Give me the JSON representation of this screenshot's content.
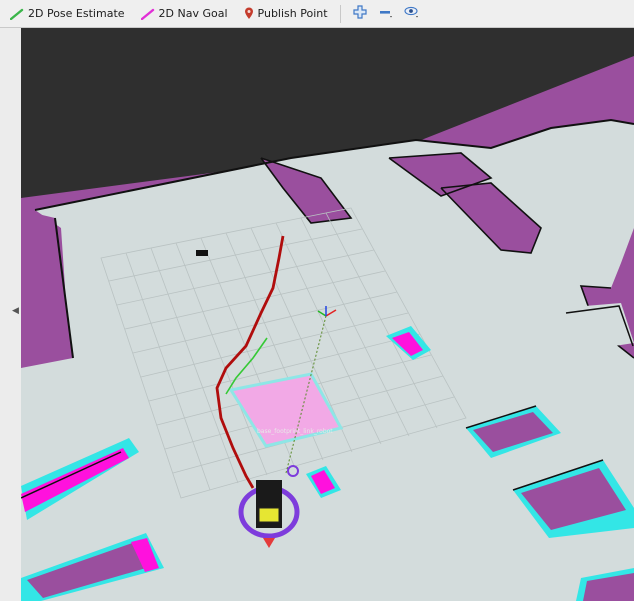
{
  "toolbar": {
    "pose_estimate": "2D Pose Estimate",
    "nav_goal": "2D Nav Goal",
    "publish_point": "Publish Point"
  },
  "icons": {
    "pose_estimate": "pose-arrow-icon",
    "nav_goal": "goal-arrow-icon",
    "publish_point": "map-pin-icon",
    "add": "move-cross-icon",
    "remove": "minus-icon",
    "view": "eye-icon"
  },
  "scene": {
    "colors": {
      "background": "#2f2f2f",
      "free_space": "#d3dcdc",
      "unknown": "#9a4f9e",
      "obstacle": "#101010",
      "inflation": "#33e6e6",
      "lethal": "#ff11dd",
      "global_path": "#b00d0d",
      "local_path": "#35c935",
      "local_costmap": "#f2a9e6",
      "robot_ring": "#7d3cdc"
    },
    "robot_label": "base_footprint_link_robot"
  }
}
